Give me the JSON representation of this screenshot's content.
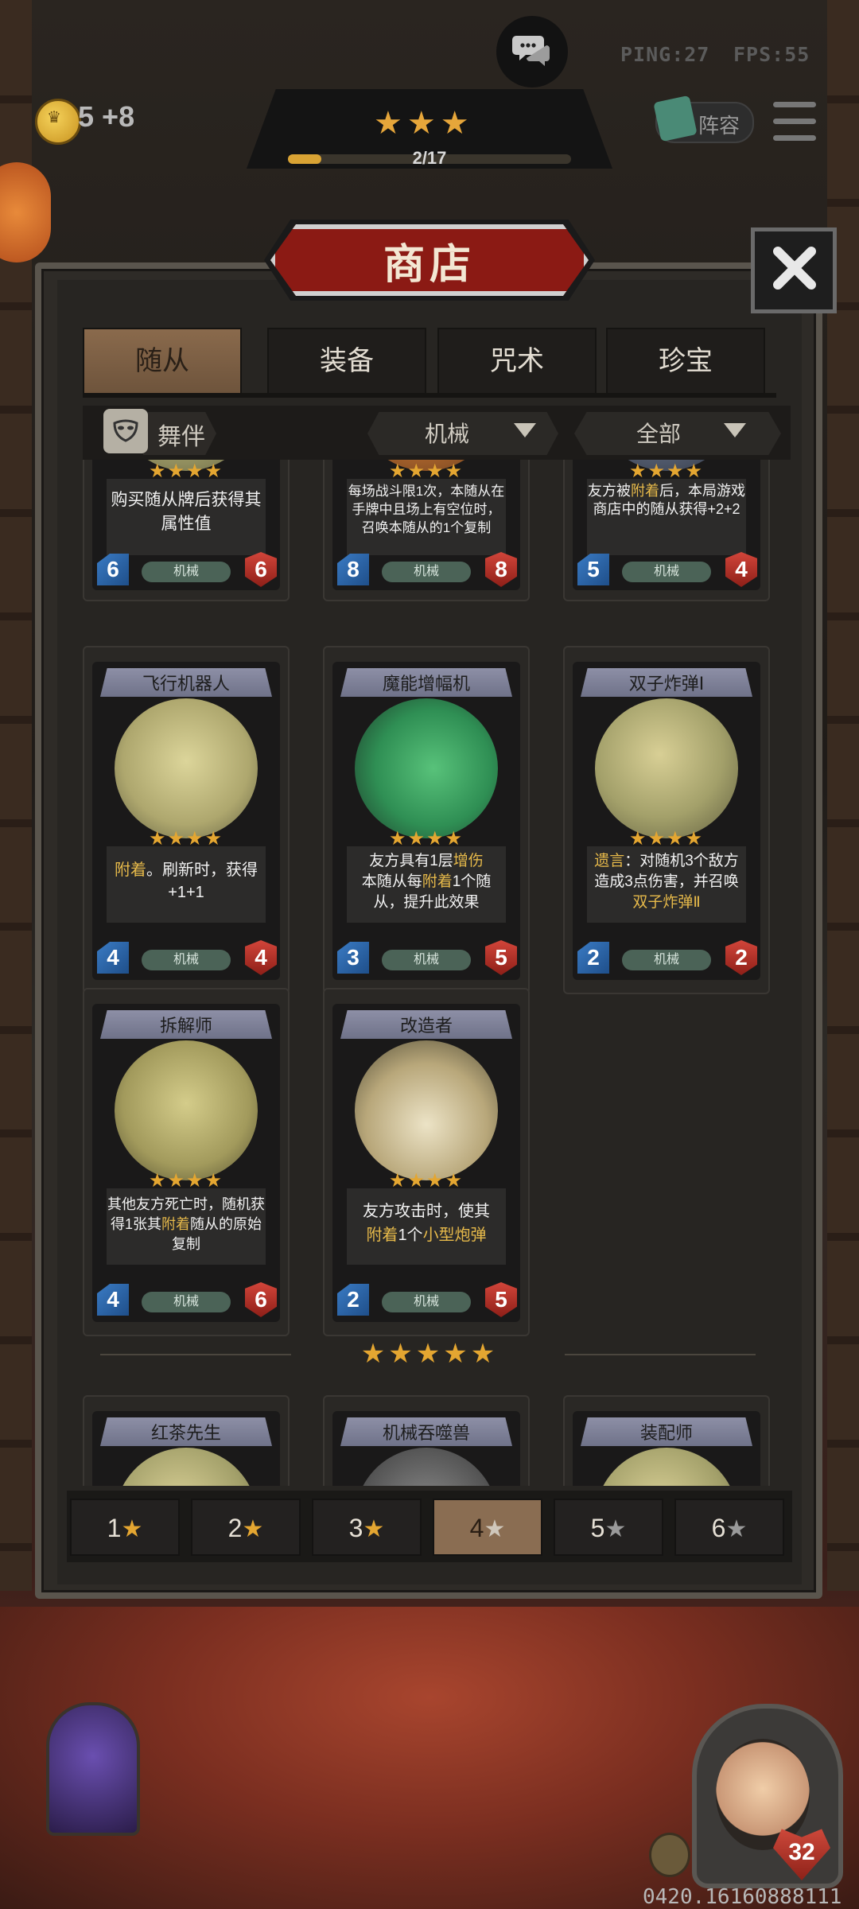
{
  "hud": {
    "gold": "5",
    "gold_income": "+8",
    "ping": "PING:27",
    "fps": "FPS:55",
    "tier_stars": "★★★",
    "progress_text": "2/17",
    "progress_value": 0.118,
    "lineup_label": "阵容",
    "icons": [
      "coin-icon",
      "chat-icon",
      "lineup-icon",
      "menu-icon",
      "chest-icon"
    ]
  },
  "shop": {
    "title": "商店",
    "tabs": [
      {
        "label": "随从",
        "active": true
      },
      {
        "label": "装备",
        "active": false
      },
      {
        "label": "咒术",
        "active": false
      },
      {
        "label": "珍宝",
        "active": false
      }
    ],
    "filter_tag": "舞伴",
    "dropdown_type": "机械",
    "dropdown_scope": "全部"
  },
  "cards": {
    "row0": [
      {
        "name": "",
        "stars": "★★★★",
        "desc": "购买随从牌后获得其属性值",
        "type": "机械",
        "atk": "6",
        "hp": "6"
      },
      {
        "name": "",
        "stars": "★★★★",
        "desc": "每场战斗限1次，本随从在手牌中且场上有空位时，召唤本随从的1个复制",
        "type": "机械",
        "atk": "8",
        "hp": "8"
      },
      {
        "name": "",
        "stars": "★★★★",
        "desc_parts": [
          "友方被",
          "附着",
          "后，本局游戏商店中的随从获得+2+2"
        ],
        "type": "机械",
        "atk": "5",
        "hp": "4"
      }
    ],
    "row1": [
      {
        "name": "飞行机器人",
        "stars": "★★★★",
        "desc_parts": [
          "附着",
          "。刷新时，获得+1+1"
        ],
        "type": "机械",
        "atk": "4",
        "hp": "4"
      },
      {
        "name": "魔能增幅机",
        "stars": "★★★★",
        "desc_parts": [
          "友方具有1层",
          "增伤",
          "本随从每",
          "附着",
          "1个随从，提升此效果"
        ],
        "type": "机械",
        "atk": "3",
        "hp": "5"
      },
      {
        "name": "双子炸弹Ⅰ",
        "stars": "★★★★",
        "desc_parts": [
          "遗言",
          "：对随机3个敌方造成3点伤害，并召唤",
          "双子炸弹Ⅱ"
        ],
        "type": "机械",
        "atk": "2",
        "hp": "2"
      }
    ],
    "row2": [
      {
        "name": "拆解师",
        "stars": "★★★★",
        "desc_parts": [
          "其他友方死亡时，随机获得1张其",
          "附着",
          "随从的原始复制"
        ],
        "type": "机械",
        "atk": "4",
        "hp": "6"
      },
      {
        "name": "改造者",
        "stars": "★★★★",
        "desc_parts": [
          "友方攻击时，使其",
          "附着",
          "1个",
          "小型炮弹"
        ],
        "type": "机械",
        "atk": "2",
        "hp": "5"
      }
    ],
    "tier5_stars": "★★★★★",
    "row3": [
      {
        "name": "红茶先生"
      },
      {
        "name": "机械吞噬兽"
      },
      {
        "name": "装配师"
      }
    ]
  },
  "tier_filter": [
    {
      "label": "1",
      "active": false,
      "dim": false
    },
    {
      "label": "2",
      "active": false,
      "dim": false
    },
    {
      "label": "3",
      "active": false,
      "dim": false
    },
    {
      "label": "4",
      "active": true,
      "dim": false
    },
    {
      "label": "5",
      "active": false,
      "dim": true
    },
    {
      "label": "6",
      "active": false,
      "dim": true
    }
  ],
  "hero": {
    "hp": "32"
  },
  "build_id": "0420.16160888111",
  "colors": {
    "accent_gold": "#e4a631",
    "shop_red": "#8b1a14",
    "type_badge": "#4b6357"
  }
}
